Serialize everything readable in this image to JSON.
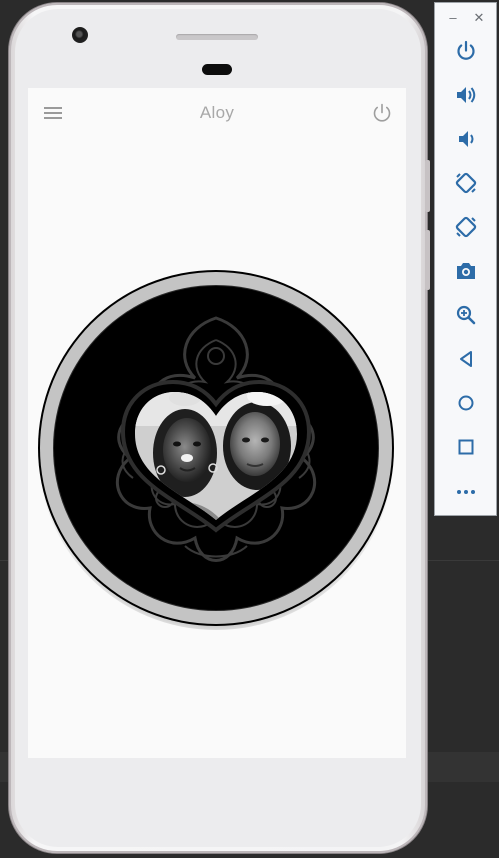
{
  "app": {
    "title": "Aloy"
  },
  "emulator": {
    "minimize_glyph": "–",
    "close_glyph": "✕",
    "tools": [
      {
        "icon": "power-icon"
      },
      {
        "icon": "volume-up-icon"
      },
      {
        "icon": "volume-down-icon"
      },
      {
        "icon": "rotate-left-icon"
      },
      {
        "icon": "rotate-right-icon"
      },
      {
        "icon": "camera-icon"
      },
      {
        "icon": "zoom-icon"
      },
      {
        "icon": "back-icon"
      },
      {
        "icon": "home-icon"
      },
      {
        "icon": "overview-icon"
      },
      {
        "icon": "more-icon"
      }
    ]
  },
  "colors": {
    "accent_icon": "#2d6ca8",
    "title_text": "#a8a8a8",
    "screen_bg": "#fafafa"
  }
}
